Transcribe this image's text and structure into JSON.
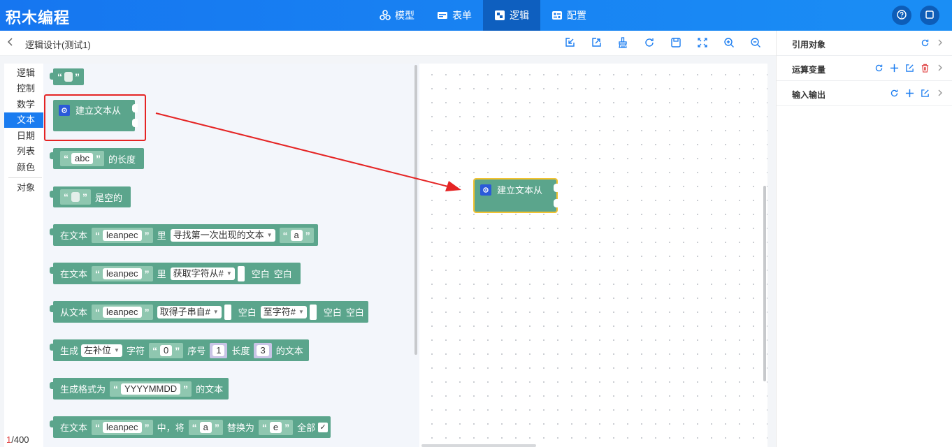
{
  "app": {
    "title": "积木编程",
    "nav": [
      {
        "label": "模型",
        "icon": "model-icon"
      },
      {
        "label": "表单",
        "icon": "form-icon"
      },
      {
        "label": "逻辑",
        "icon": "logic-icon",
        "active": true
      },
      {
        "label": "配置",
        "icon": "config-icon"
      }
    ],
    "header_icons": [
      "help-icon",
      "window-icon"
    ],
    "accent": "#1a7cf0"
  },
  "subbar": {
    "title": "逻辑设计(测试1)",
    "toolbar_icons": [
      "import-icon",
      "export-icon",
      "clean-icon",
      "refresh-icon",
      "save-icon",
      "fit-icon",
      "zoom-in-icon",
      "zoom-out-icon"
    ]
  },
  "categories": {
    "items": [
      "逻辑",
      "控制",
      "数学",
      "文本",
      "日期",
      "列表",
      "颜色",
      "对象"
    ],
    "active": "文本"
  },
  "blocks": {
    "quote_open": "“",
    "quote_close": "”",
    "create_text": "建立文本从",
    "length_val": "abc",
    "length_lbl": "的长度",
    "empty_lbl": "是空的",
    "in_text": "在文本",
    "leanpec": "leanpec",
    "li": "里",
    "find_first": "寻找第一次出现的文本",
    "a": "a",
    "get_char_from": "获取字符从#",
    "blank": "空白",
    "from_text": "从文本",
    "substr_from": "取得子串自#",
    "to_char": "至字符#",
    "gen": "生成",
    "pad_left": "左补位",
    "char": "字符",
    "zero": "0",
    "index": "序号",
    "one": "1",
    "length": "长度",
    "three": "3",
    "of_text": "的文本",
    "gen_format": "生成格式为",
    "format_val": "YYYYMMDD",
    "replace_mid": "中，将",
    "e": "e",
    "replace_with": "替换为",
    "all": "全部",
    "check": "✓"
  },
  "counter": {
    "current": "1",
    "total": "/400"
  },
  "right_panel": {
    "rows": [
      {
        "label": "引用对象"
      },
      {
        "label": "运算变量"
      },
      {
        "label": "输入输出"
      }
    ],
    "colors": {
      "blue": "#1a7cf0",
      "red": "#e04646"
    }
  }
}
